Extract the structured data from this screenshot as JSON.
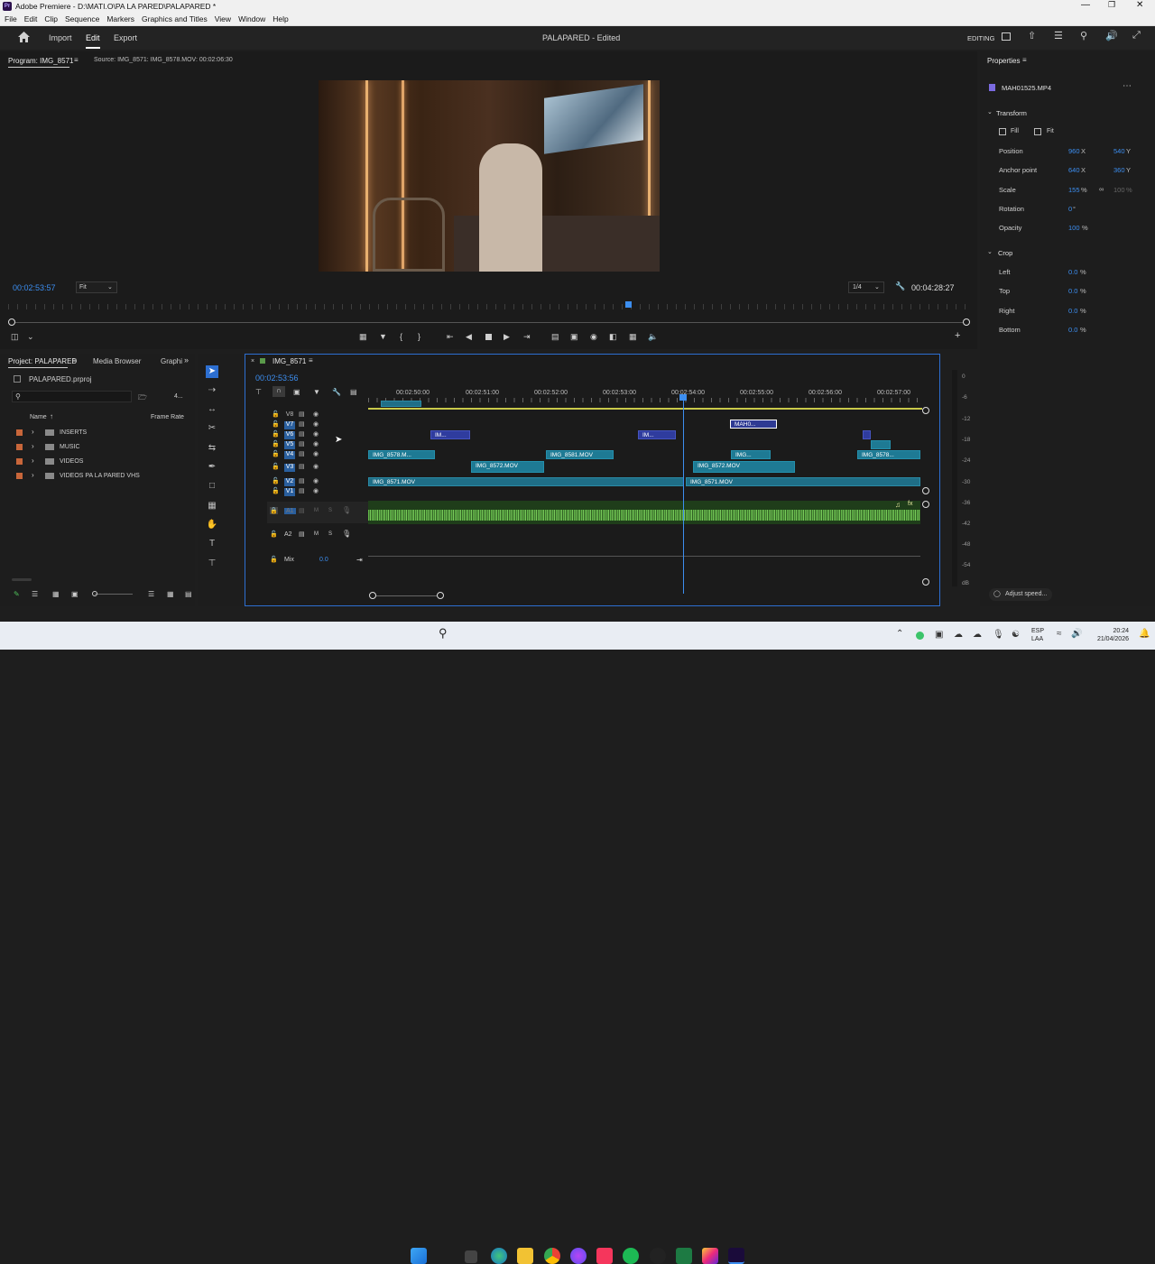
{
  "window": {
    "title": "Adobe Premiere - D:\\MATI.O\\PA LA PARED\\PALAPARED *",
    "app_icon": "Pr"
  },
  "menu": [
    "File",
    "Edit",
    "Clip",
    "Sequence",
    "Markers",
    "Graphics and Titles",
    "View",
    "Window",
    "Help"
  ],
  "header": {
    "tabs": [
      "Import",
      "Edit",
      "Export"
    ],
    "active_tab": "Edit",
    "project_title": "PALAPARED - Edited",
    "workspace": "EDITING"
  },
  "program_monitor": {
    "tab_label": "Program: IMG_8571",
    "source_label": "Source: IMG_8571: IMG_8578.MOV: 00:02:06:30",
    "current_time": "00:02:53:57",
    "fit_label": "Fit",
    "quality": "1/4",
    "duration": "00:04:28:27"
  },
  "properties": {
    "panel_title": "Properties",
    "clip_name": "MAH01525.MP4",
    "transform_header": "Transform",
    "fill_label": "Fill",
    "fit_label": "Fit",
    "rows": [
      {
        "label": "Position",
        "v1": "960",
        "u1": "X",
        "v2": "540",
        "u2": "Y"
      },
      {
        "label": "Anchor point",
        "v1": "640",
        "u1": "X",
        "v2": "360",
        "u2": "Y"
      },
      {
        "label": "Scale",
        "v1": "155",
        "u1": "%",
        "v2": "100",
        "u2": "%"
      },
      {
        "label": "Rotation",
        "v1": "0",
        "u1": "°",
        "v2": "",
        "u2": ""
      },
      {
        "label": "Opacity",
        "v1": "100",
        "u1": "%",
        "v2": "",
        "u2": ""
      }
    ],
    "crop_header": "Crop",
    "crop_rows": [
      {
        "label": "Left",
        "value": "0.0",
        "unit": "%"
      },
      {
        "label": "Top",
        "value": "0.0",
        "unit": "%"
      },
      {
        "label": "Right",
        "value": "0.0",
        "unit": "%"
      },
      {
        "label": "Bottom",
        "value": "0.0",
        "unit": "%"
      }
    ],
    "adjust_speed": "Adjust speed..."
  },
  "project": {
    "tab_label": "Project: PALAPARED",
    "media_browser": "Media Browser",
    "graphics_tab": "Graphi",
    "file_name": "PALAPARED.prproj",
    "item_count": "4...",
    "col_name": "Name",
    "col_framerate": "Frame Rate",
    "folders": [
      "INSERTS",
      "MUSIC",
      "VIDEOS",
      "VIDEOS PA LA PARED VHS"
    ]
  },
  "timeline": {
    "tab_label": "IMG_8571",
    "current_time": "00:02:53:56",
    "ruler": [
      "00:02:50:00",
      "00:02:51:00",
      "00:02:52:00",
      "00:02:53:00",
      "00:02:54:00",
      "00:02:55:00",
      "00:02:56:00",
      "00:02:57:00"
    ],
    "video_tracks": [
      "V8",
      "V7",
      "V6",
      "V5",
      "V4",
      "V3",
      "V2",
      "V1"
    ],
    "audio_tracks": [
      "A1",
      "A2"
    ],
    "mix_label": "Mix",
    "mix_value": "0.0",
    "clips": {
      "v6_a": "IM...",
      "v6_b": "IM...",
      "v7": "MAH0...",
      "v4_a": "IMG_8578.M...",
      "v4_b": "IMG_8581.MOV",
      "v4_c": "IMG...",
      "v4_d": "IMG_8578...",
      "v3_a": "IMG_8572.MOV",
      "v3_b": "IMG_8572.MOV",
      "v2_a": "IMG_8571.MOV",
      "v2_b": "IMG_8571.MOV",
      "fx": "fx"
    },
    "meter_ticks": [
      "0",
      "-6",
      "-12",
      "-18",
      "-24",
      "-30",
      "-36",
      "-42",
      "-48",
      "-54",
      "dB"
    ]
  },
  "taskbar": {
    "lang": "ESP",
    "lang2": "LAA",
    "time": "20:24",
    "date": "21/04/2026"
  }
}
